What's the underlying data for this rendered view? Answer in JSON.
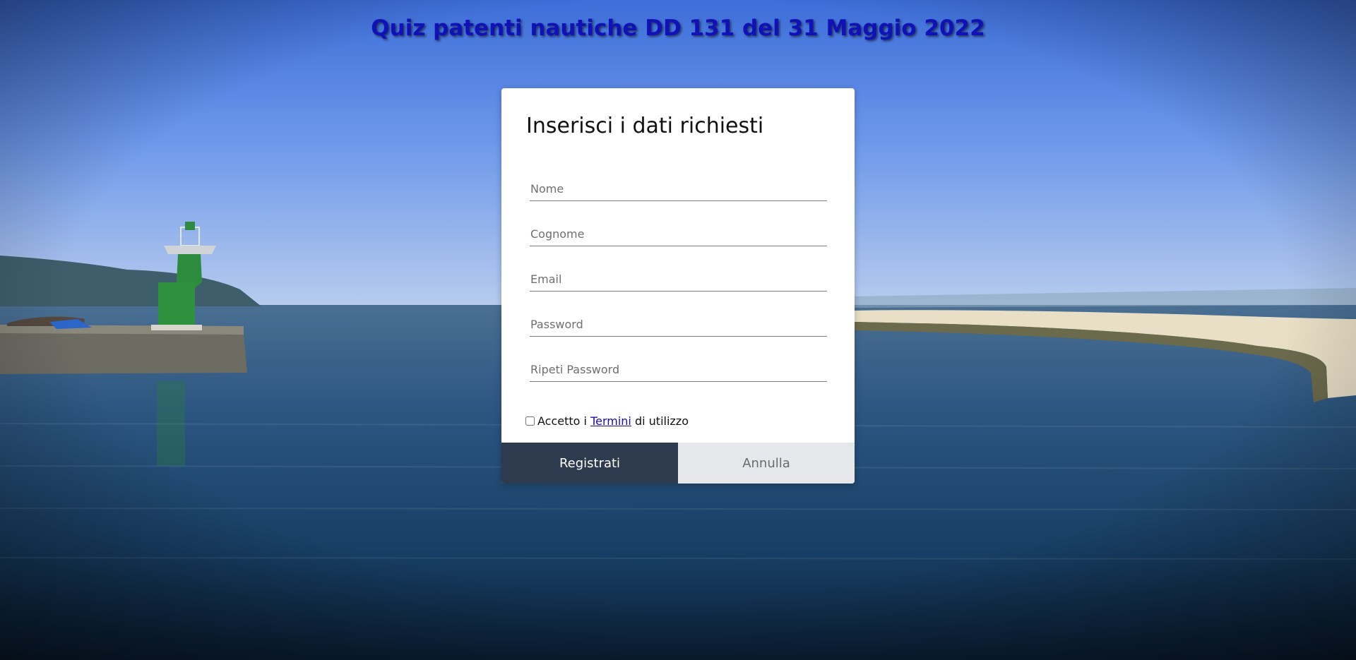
{
  "header": {
    "title": "Quiz patenti nautiche DD 131 del 31 Maggio 2022"
  },
  "background": {
    "description_icon": "harbour-sea-photo"
  },
  "form": {
    "heading": "Inserisci i dati richiesti",
    "fields": {
      "nome": {
        "placeholder": "Nome",
        "value": ""
      },
      "cognome": {
        "placeholder": "Cognome",
        "value": ""
      },
      "email": {
        "placeholder": "Email",
        "value": ""
      },
      "password": {
        "placeholder": "Password",
        "value": ""
      },
      "ripeti_password": {
        "placeholder": "Ripeti Password",
        "value": ""
      }
    },
    "terms": {
      "checked": false,
      "prefix": "Accetto i",
      "link": "Termini",
      "suffix": "di utilizzo"
    },
    "buttons": {
      "register": "Registrati",
      "cancel": "Annulla"
    }
  },
  "colors": {
    "title": "#1111b8",
    "register_bg": "#2e3a4e",
    "cancel_bg": "#e6e7ea",
    "link": "#1a0dab"
  }
}
